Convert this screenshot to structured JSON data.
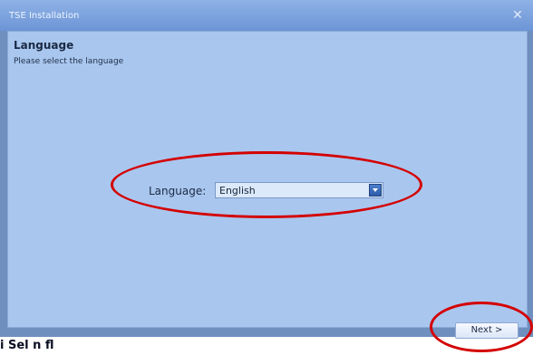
{
  "window": {
    "title": "TSE Installation",
    "close_glyph": "✕"
  },
  "header": {
    "title": "Language",
    "subtitle": "Please select the language"
  },
  "language": {
    "label": "Language:",
    "selected": "English"
  },
  "footer": {
    "next_label": "Next >"
  },
  "caption": {
    "text": "i    Sel   n  fl"
  },
  "colors": {
    "annotation": "#d40000",
    "background": "#a9c6ee"
  },
  "icons": {
    "dropdown": "chevron-down-icon",
    "close": "close-icon"
  }
}
